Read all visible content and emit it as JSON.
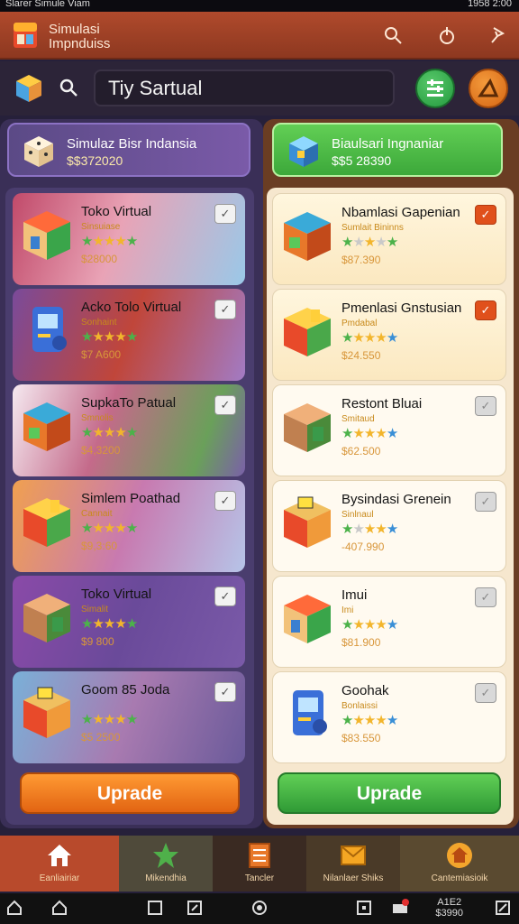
{
  "status_bar": {
    "left_text": "Slarer Simule Viam",
    "right_text": "1958 2:00"
  },
  "app_bar": {
    "title": "Simulasi Impnduiss",
    "icons": [
      "app-logo-icon",
      "search-icon",
      "tag-icon",
      "pin-icon"
    ]
  },
  "search": {
    "value": "Tiy Sartual",
    "icons": [
      "cube-icon",
      "search-icon",
      "filter-icon",
      "alert-icon"
    ]
  },
  "left_panel": {
    "banner": {
      "title": "Simulaz Bisr Indansia",
      "price": "$$372020"
    },
    "items": [
      {
        "name": "Toko Virtual",
        "subtitle": "Sinsuiase",
        "stars": [
          "g",
          "y",
          "y",
          "y",
          "g"
        ],
        "price": "$28000",
        "checked": false
      },
      {
        "name": "Acko Tolo Virtual",
        "subtitle": "Sonhaint",
        "stars": [
          "g",
          "y",
          "y",
          "y",
          "g"
        ],
        "price": "$7 A600",
        "checked": false
      },
      {
        "name": "SupkaTo Patual",
        "subtitle": "Smnolis",
        "stars": [
          "g",
          "y",
          "y",
          "y",
          "g"
        ],
        "price": "$4,3200",
        "checked": false
      },
      {
        "name": "Simlem Poathad",
        "subtitle": "Cannait",
        "stars": [
          "g",
          "y",
          "y",
          "y",
          "g"
        ],
        "price": "$9,3:60",
        "checked": false
      },
      {
        "name": "Toko Virtual",
        "subtitle": "Simalit",
        "stars": [
          "g",
          "y",
          "y",
          "y",
          "g"
        ],
        "price": "$9 800",
        "checked": false
      },
      {
        "name": "Goom 85 Joda",
        "subtitle": "",
        "stars": [
          "g",
          "y",
          "y",
          "y",
          "g"
        ],
        "price": "$5 2500",
        "checked": false
      }
    ],
    "upgrade_label": "Uprade"
  },
  "right_panel": {
    "banner": {
      "title": "Biaulsari Ingnaniar",
      "price": "$$5 28390"
    },
    "items": [
      {
        "name": "Nbamlasi Gapenian",
        "subtitle": "Sumlait Bininns",
        "stars": [
          "g",
          "e",
          "y",
          "e",
          "g"
        ],
        "price": "$87.390",
        "checked": true
      },
      {
        "name": "Pmenlasi Gnstusian",
        "subtitle": "Pmdabal",
        "stars": [
          "g",
          "y",
          "y",
          "y",
          "b"
        ],
        "price": "$24.550",
        "checked": true
      },
      {
        "name": "Restont Bluai",
        "subtitle": "Smitaud",
        "stars": [
          "g",
          "y",
          "y",
          "y",
          "b"
        ],
        "price": "$62.500",
        "checked": false
      },
      {
        "name": "Bysindasi Grenein",
        "subtitle": "Sinlnaul",
        "stars": [
          "g",
          "e",
          "y",
          "y",
          "b"
        ],
        "price": "-407.990",
        "checked": false
      },
      {
        "name": "Imui",
        "subtitle": "Imi",
        "stars": [
          "g",
          "y",
          "y",
          "y",
          "b"
        ],
        "price": "$81.900",
        "checked": false
      },
      {
        "name": "Goohak",
        "subtitle": "Bonlaissi",
        "stars": [
          "g",
          "y",
          "y",
          "y",
          "b"
        ],
        "price": "$83.550",
        "checked": false
      }
    ],
    "upgrade_label": "Uprade"
  },
  "bottom_nav": [
    {
      "label": "Eanliairiar",
      "icon": "home-icon"
    },
    {
      "label": "Mikendhia",
      "icon": "star-icon"
    },
    {
      "label": "Tancler",
      "icon": "list-icon"
    },
    {
      "label": "Nilanlaer Shiks",
      "icon": "mail-icon"
    },
    {
      "label": "Cantemiasioik",
      "icon": "house-icon"
    }
  ],
  "system_bar": {
    "clock_top": "A1E2",
    "clock_bottom": "$3990",
    "badge": "1"
  },
  "colors": {
    "app_bar": "#9e4226",
    "left_panel": "#4a3d6e",
    "right_panel": "#f6e7ce",
    "upgrade_orange": "#f07a20",
    "upgrade_green": "#3fb040"
  }
}
